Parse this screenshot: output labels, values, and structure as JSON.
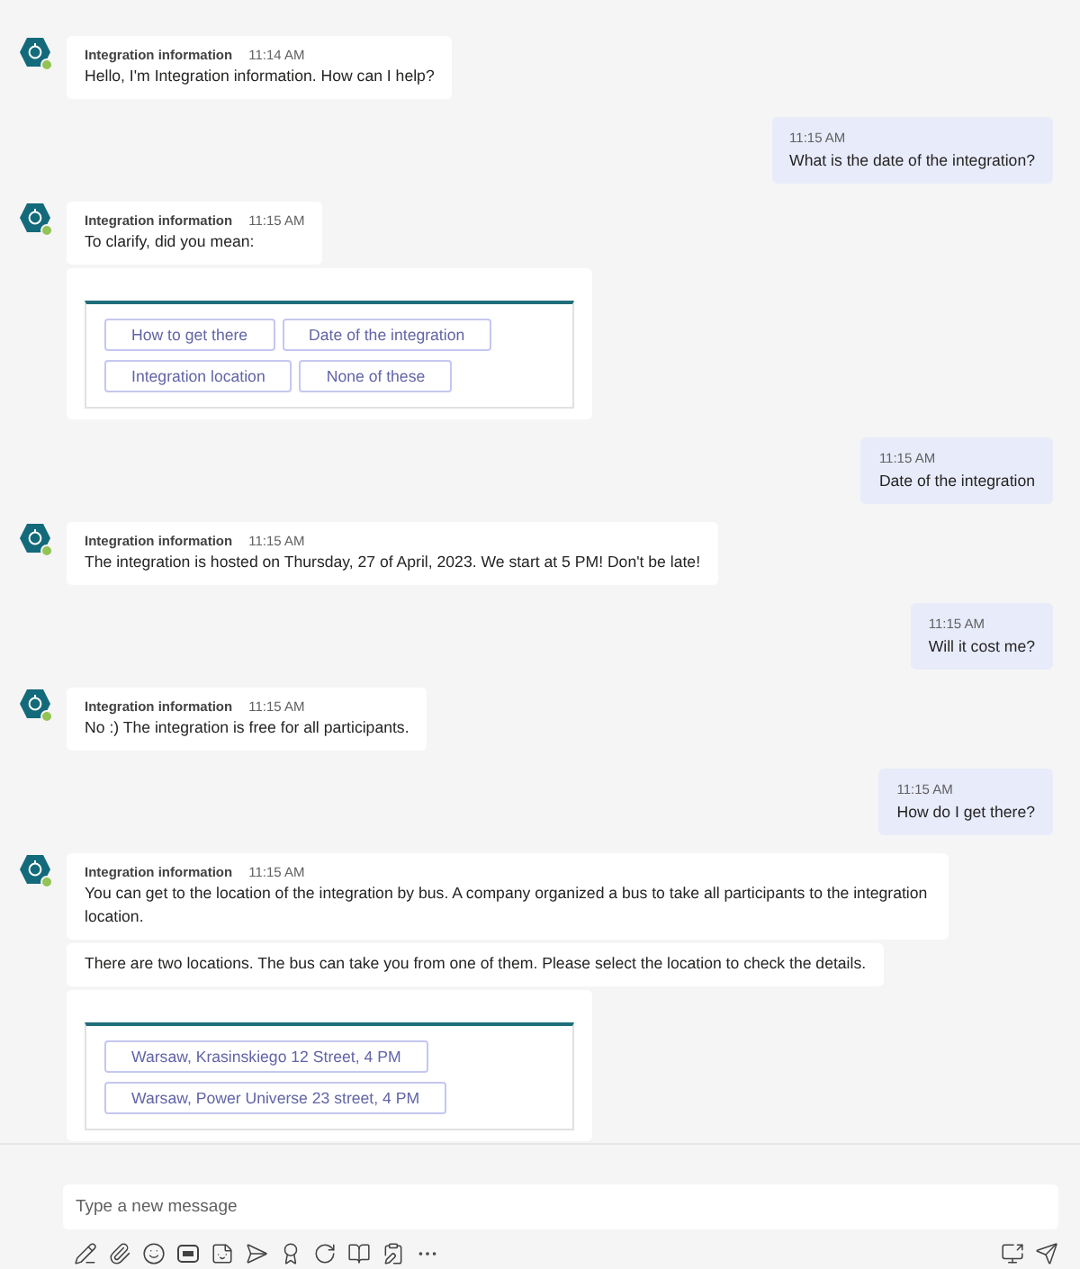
{
  "messages": [
    {
      "kind": "bot",
      "sender": "Integration information",
      "time": "11:14 AM",
      "paragraphs": [
        "Hello, I'm Integration information. How can I help?"
      ]
    },
    {
      "kind": "user",
      "time": "11:15 AM",
      "paragraphs": [
        "What is the date of the integration?"
      ]
    },
    {
      "kind": "bot",
      "sender": "Integration information",
      "time": "11:15 AM",
      "paragraphs": [
        "To clarify, did you mean:"
      ],
      "card_buttons": [
        "How to get there",
        "Date of the integration",
        "Integration location",
        "None of these"
      ]
    },
    {
      "kind": "user",
      "time": "11:15 AM",
      "paragraphs": [
        "Date of the integration"
      ]
    },
    {
      "kind": "bot",
      "sender": "Integration information",
      "time": "11:15 AM",
      "paragraphs": [
        "The integration is hosted on Thursday, 27 of April, 2023. We start at 5 PM! Don't be late!"
      ]
    },
    {
      "kind": "user",
      "time": "11:15 AM",
      "paragraphs": [
        "Will it cost me?"
      ]
    },
    {
      "kind": "bot",
      "sender": "Integration information",
      "time": "11:15 AM",
      "paragraphs": [
        "No :) The integration is free for all participants."
      ]
    },
    {
      "kind": "user",
      "time": "11:15 AM",
      "paragraphs": [
        "How do I get there?"
      ]
    },
    {
      "kind": "bot",
      "sender": "Integration information",
      "time": "11:15 AM",
      "paragraphs": [
        "You can get to the location of the integration by bus. A company organized a bus to take all participants to the integration location.",
        "There are two locations. The bus can take you from one of them. Please select the location to check the details."
      ],
      "card_buttons": [
        "Warsaw, Krasinskiego 12 Street, 4 PM",
        "Warsaw, Power Universe 23 street, 4 PM"
      ]
    }
  ],
  "compose": {
    "placeholder": "Type a new message"
  }
}
